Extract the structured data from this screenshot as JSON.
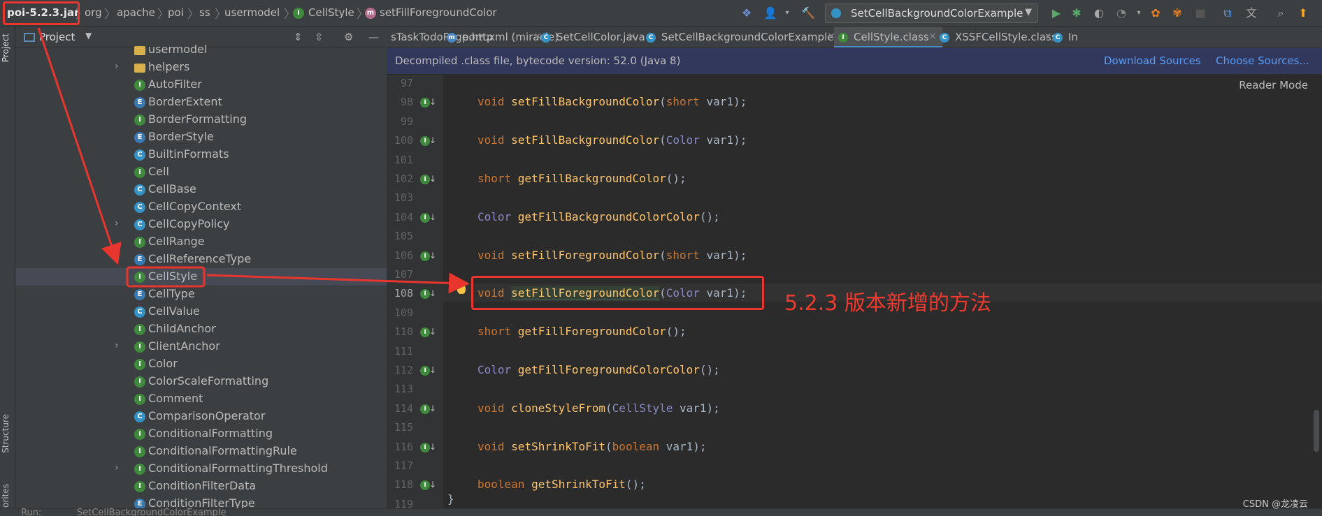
{
  "breadcrumb": {
    "jar": "poi-5.2.3.jar",
    "items": [
      "org",
      "apache",
      "poi",
      "ss",
      "usermodel",
      "CellStyle",
      "setFillForegroundColor"
    ]
  },
  "toolbar": {
    "run_config": "SetCellBackgroundColorExample"
  },
  "stripe": {
    "project_label": "Project",
    "structure_label": "Structure",
    "favorites_label": "Favorites"
  },
  "project_panel": {
    "title": "Project",
    "tree": [
      {
        "label": "usermodel",
        "icon": "folder-icon",
        "chevron": "",
        "partial": true
      },
      {
        "label": "helpers",
        "icon": "folder",
        "chevron": "›"
      },
      {
        "label": "AutoFilter",
        "icon": "I",
        "chevron": ""
      },
      {
        "label": "BorderExtent",
        "icon": "E",
        "chevron": ""
      },
      {
        "label": "BorderFormatting",
        "icon": "I",
        "chevron": ""
      },
      {
        "label": "BorderStyle",
        "icon": "E",
        "chevron": ""
      },
      {
        "label": "BuiltinFormats",
        "icon": "C",
        "chevron": ""
      },
      {
        "label": "Cell",
        "icon": "I",
        "chevron": ""
      },
      {
        "label": "CellBase",
        "icon": "C",
        "chevron": ""
      },
      {
        "label": "CellCopyContext",
        "icon": "C",
        "chevron": ""
      },
      {
        "label": "CellCopyPolicy",
        "icon": "C",
        "chevron": "›"
      },
      {
        "label": "CellRange",
        "icon": "I",
        "chevron": ""
      },
      {
        "label": "CellReferenceType",
        "icon": "E",
        "chevron": ""
      },
      {
        "label": "CellStyle",
        "icon": "I",
        "chevron": "",
        "selected": true
      },
      {
        "label": "CellType",
        "icon": "E",
        "chevron": ""
      },
      {
        "label": "CellValue",
        "icon": "C",
        "chevron": ""
      },
      {
        "label": "ChildAnchor",
        "icon": "I",
        "chevron": ""
      },
      {
        "label": "ClientAnchor",
        "icon": "I",
        "chevron": "›"
      },
      {
        "label": "Color",
        "icon": "I",
        "chevron": ""
      },
      {
        "label": "ColorScaleFormatting",
        "icon": "I",
        "chevron": ""
      },
      {
        "label": "Comment",
        "icon": "I",
        "chevron": ""
      },
      {
        "label": "ComparisonOperator",
        "icon": "C",
        "chevron": ""
      },
      {
        "label": "ConditionalFormatting",
        "icon": "I",
        "chevron": ""
      },
      {
        "label": "ConditionalFormattingRule",
        "icon": "I",
        "chevron": ""
      },
      {
        "label": "ConditionalFormattingThreshold",
        "icon": "I",
        "chevron": "›"
      },
      {
        "label": "ConditionFilterData",
        "icon": "I",
        "chevron": ""
      },
      {
        "label": "ConditionFilterType",
        "icon": "E",
        "chevron": ""
      }
    ]
  },
  "tabs": [
    {
      "label": "sTaskTodoPage.http",
      "icon": ""
    },
    {
      "label": "pom.xml (miracle)",
      "icon": "m"
    },
    {
      "label": "SetCellColor.java",
      "icon": "C"
    },
    {
      "label": "SetCellBackgroundColorExample.java",
      "icon": "C"
    },
    {
      "label": "CellStyle.class",
      "icon": "I",
      "active": true
    },
    {
      "label": "XSSFCellStyle.class",
      "icon": "C"
    },
    {
      "label": "In",
      "icon": "C"
    }
  ],
  "notice": {
    "text": "Decompiled .class file, bytecode version: 52.0 (Java 8)",
    "download": "Download Sources",
    "choose": "Choose Sources..."
  },
  "editor": {
    "reader_mode": "Reader Mode",
    "lines": [
      {
        "n": "97",
        "code": []
      },
      {
        "n": "98",
        "gi": true,
        "code": [
          [
            "kw",
            "void "
          ],
          [
            "fn",
            "setFillBackgroundColor"
          ],
          [
            "p",
            "("
          ],
          [
            "kw",
            "short "
          ],
          [
            "p",
            "var1);"
          ]
        ]
      },
      {
        "n": "99",
        "code": []
      },
      {
        "n": "100",
        "gi": true,
        "code": [
          [
            "kw",
            "void "
          ],
          [
            "fn",
            "setFillBackgroundColor"
          ],
          [
            "p",
            "("
          ],
          [
            "ty",
            "Color "
          ],
          [
            "p",
            "var1);"
          ]
        ]
      },
      {
        "n": "101",
        "code": []
      },
      {
        "n": "102",
        "gi": true,
        "code": [
          [
            "kw",
            "short "
          ],
          [
            "fn",
            "getFillBackgroundColor"
          ],
          [
            "p",
            "();"
          ]
        ]
      },
      {
        "n": "103",
        "code": []
      },
      {
        "n": "104",
        "gi": true,
        "code": [
          [
            "ty",
            "Color "
          ],
          [
            "fn",
            "getFillBackgroundColorColor"
          ],
          [
            "p",
            "();"
          ]
        ]
      },
      {
        "n": "105",
        "code": []
      },
      {
        "n": "106",
        "gi": true,
        "code": [
          [
            "kw",
            "void "
          ],
          [
            "fn",
            "setFillForegroundColor"
          ],
          [
            "p",
            "("
          ],
          [
            "kw",
            "short "
          ],
          [
            "p",
            "var1);"
          ]
        ]
      },
      {
        "n": "107",
        "code": []
      },
      {
        "n": "108",
        "gi": true,
        "cur": true,
        "code": [
          [
            "kw",
            "void "
          ],
          [
            "fnhl",
            "setFillForegroundColor"
          ],
          [
            "p",
            "("
          ],
          [
            "ty",
            "Color "
          ],
          [
            "p",
            "var1);"
          ]
        ]
      },
      {
        "n": "109",
        "code": []
      },
      {
        "n": "110",
        "gi": true,
        "code": [
          [
            "kw",
            "short "
          ],
          [
            "fn",
            "getFillForegroundColor"
          ],
          [
            "p",
            "();"
          ]
        ]
      },
      {
        "n": "111",
        "code": []
      },
      {
        "n": "112",
        "gi": true,
        "code": [
          [
            "ty",
            "Color "
          ],
          [
            "fn",
            "getFillForegroundColorColor"
          ],
          [
            "p",
            "();"
          ]
        ]
      },
      {
        "n": "113",
        "code": []
      },
      {
        "n": "114",
        "gi": true,
        "code": [
          [
            "kw",
            "void "
          ],
          [
            "fn",
            "cloneStyleFrom"
          ],
          [
            "p",
            "("
          ],
          [
            "ty",
            "CellStyle "
          ],
          [
            "p",
            "var1);"
          ]
        ]
      },
      {
        "n": "115",
        "code": []
      },
      {
        "n": "116",
        "gi": true,
        "code": [
          [
            "kw",
            "void "
          ],
          [
            "fn",
            "setShrinkToFit"
          ],
          [
            "p",
            "("
          ],
          [
            "kw",
            "boolean "
          ],
          [
            "p",
            "var1);"
          ]
        ]
      },
      {
        "n": "117",
        "code": []
      },
      {
        "n": "118",
        "gi": true,
        "code": [
          [
            "kw",
            "boolean "
          ],
          [
            "fn",
            "getShrinkToFit"
          ],
          [
            "p",
            "();"
          ]
        ]
      },
      {
        "n": "119",
        "code": []
      }
    ],
    "closing_brace": "}"
  },
  "annotation": "5.2.3 版本新增的方法",
  "bottombar": {
    "run_label": "Run:",
    "run_config": "SetCellBackgroundColorExample"
  },
  "watermark": "CSDN @龙凌云",
  "colors": {
    "highlight_red": "#e8362f",
    "accent_blue": "#589df6",
    "interface_green": "#3f8a3c"
  }
}
